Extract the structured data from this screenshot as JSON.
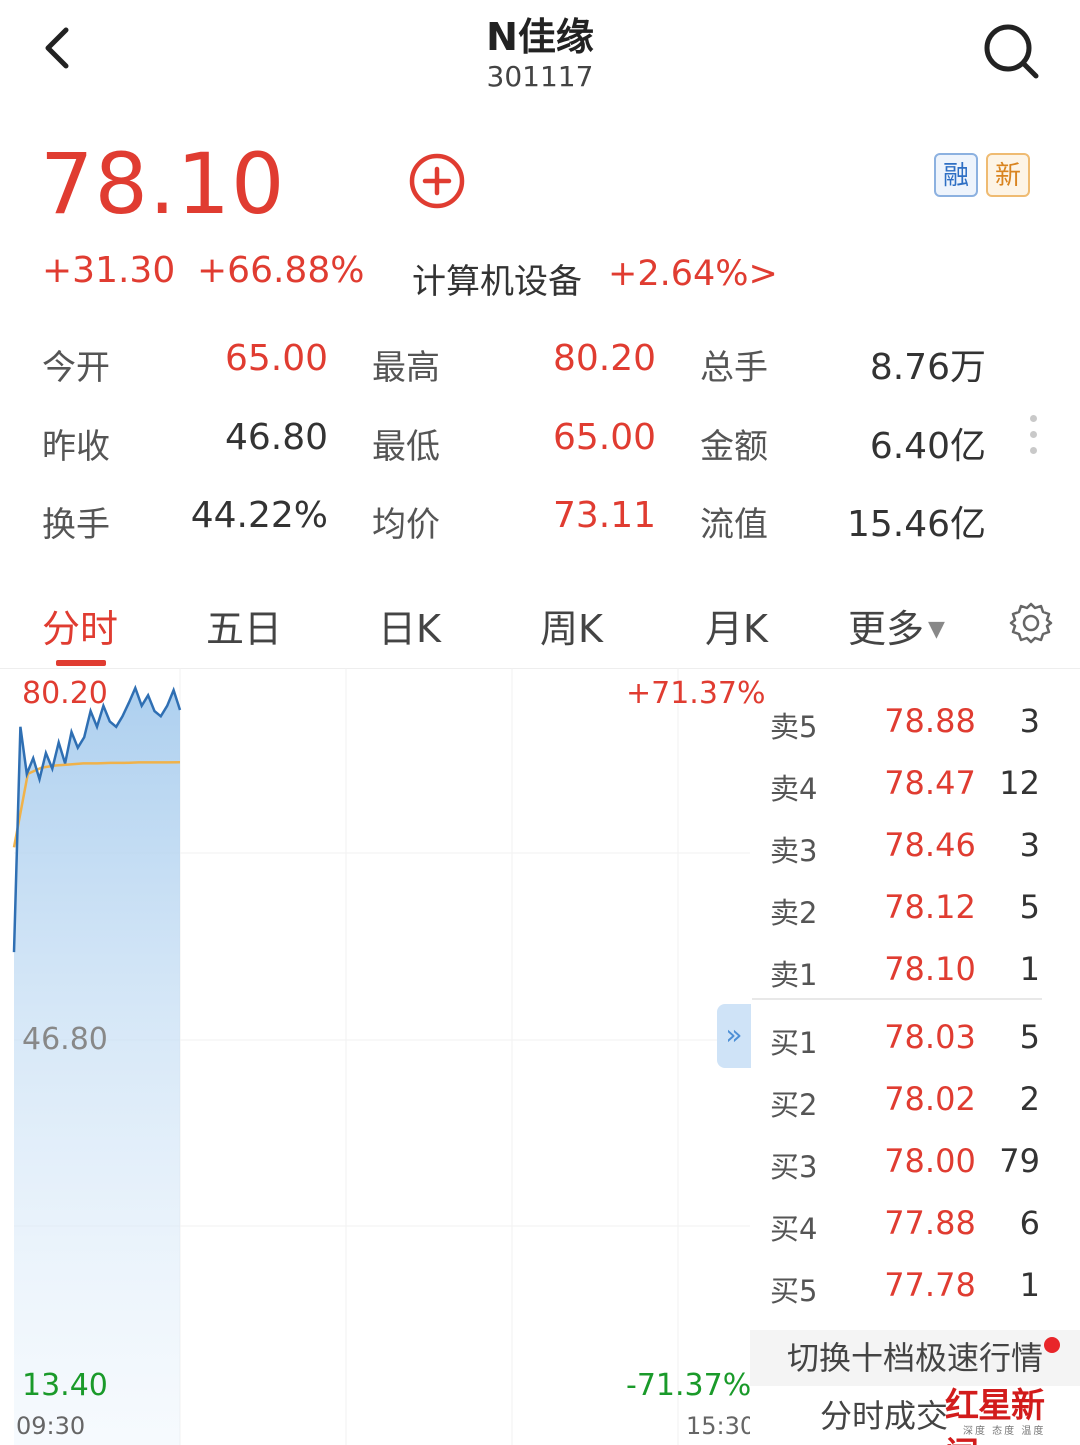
{
  "header": {
    "title": "N佳缘",
    "code": "301117"
  },
  "quote": {
    "price": "78.10",
    "change_abs": "+31.30",
    "change_pct": "+66.88%",
    "sector_name": "计算机设备",
    "sector_change": "+2.64%>",
    "badges": [
      "融",
      "新"
    ]
  },
  "stats": [
    [
      {
        "label": "今开",
        "value": "65.00",
        "color": "red"
      },
      {
        "label": "最高",
        "value": "80.20",
        "color": "red"
      },
      {
        "label": "总手",
        "value": "8.76万",
        "color": "dark"
      }
    ],
    [
      {
        "label": "昨收",
        "value": "46.80",
        "color": "dark"
      },
      {
        "label": "最低",
        "value": "65.00",
        "color": "red"
      },
      {
        "label": "金额",
        "value": "6.40亿",
        "color": "dark"
      }
    ],
    [
      {
        "label": "换手",
        "value": "44.22%",
        "color": "dark"
      },
      {
        "label": "均价",
        "value": "73.11",
        "color": "red"
      },
      {
        "label": "流值",
        "value": "15.46亿",
        "color": "dark"
      }
    ]
  ],
  "tabs": [
    "分时",
    "五日",
    "日K",
    "周K",
    "月K",
    "更多"
  ],
  "active_tab": "分时",
  "chart": {
    "y_top": "80.20",
    "y_mid": "46.80",
    "y_bottom": "13.40",
    "pct_top": "+71.37%",
    "pct_bottom": "-71.37%",
    "time_start": "09:30",
    "time_end": "15:30",
    "price_line_color": "#2f6fb3",
    "avg_line_color": "#f0b24a",
    "up_color": "#e03c31",
    "down_color": "#1a9a2a"
  },
  "chart_data": {
    "type": "line",
    "ylim": [
      13.4,
      80.2
    ],
    "series": [
      {
        "values": [
          55.0,
          76.5,
          72.0,
          73.5,
          71.5,
          74.0,
          72.5,
          75.0,
          73.0,
          76.0,
          74.5,
          75.5,
          78.0,
          76.5,
          78.5,
          77.0,
          76.5,
          77.5,
          78.8,
          80.2,
          78.5,
          79.5,
          78.0,
          77.5,
          78.5,
          80.0,
          78.1
        ]
      },
      {
        "values": [
          65.0,
          72.0,
          72.6,
          72.8,
          72.9,
          73.0,
          73.0,
          73.05,
          73.05,
          73.1,
          73.1,
          73.1,
          73.11
        ]
      }
    ]
  },
  "order_book": {
    "sell": [
      {
        "label": "卖5",
        "price": "78.88",
        "volume": "3"
      },
      {
        "label": "卖4",
        "price": "78.47",
        "volume": "12"
      },
      {
        "label": "卖3",
        "price": "78.46",
        "volume": "3"
      },
      {
        "label": "卖2",
        "price": "78.12",
        "volume": "5"
      },
      {
        "label": "卖1",
        "price": "78.10",
        "volume": "1"
      }
    ],
    "buy": [
      {
        "label": "买1",
        "price": "78.03",
        "volume": "5"
      },
      {
        "label": "买2",
        "price": "78.02",
        "volume": "2"
      },
      {
        "label": "买3",
        "price": "78.00",
        "volume": "79"
      },
      {
        "label": "买4",
        "price": "77.88",
        "volume": "6"
      },
      {
        "label": "买5",
        "price": "77.78",
        "volume": "1"
      }
    ]
  },
  "bottom": {
    "switch_label": "切换十档极速行情",
    "trades_label": "分时成交"
  },
  "watermark": {
    "name": "红星新闻",
    "tagline": "深度 态度 温度"
  }
}
